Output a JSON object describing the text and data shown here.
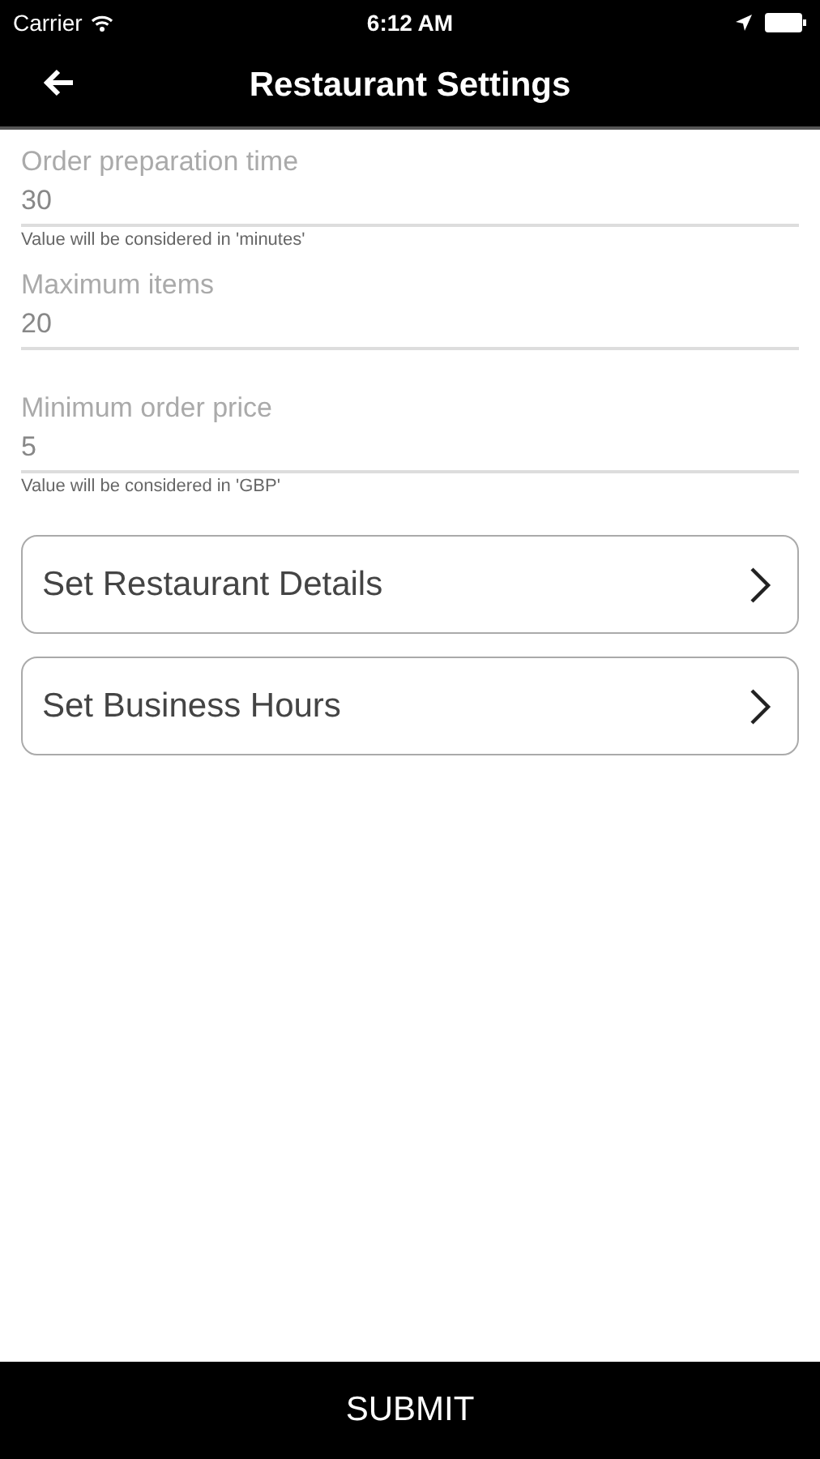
{
  "status_bar": {
    "carrier": "Carrier",
    "time": "6:12 AM"
  },
  "nav": {
    "title": "Restaurant Settings"
  },
  "fields": [
    {
      "label": "Order preparation time",
      "value": "30",
      "hint": "Value will be considered in 'minutes'"
    },
    {
      "label": "Maximum items",
      "value": "20"
    },
    {
      "label": "Minimum order price",
      "value": "5",
      "hint": "Value will be considered in 'GBP'"
    }
  ],
  "links": [
    "Set Restaurant Details",
    "Set Business Hours"
  ],
  "submit": "SUBMIT"
}
